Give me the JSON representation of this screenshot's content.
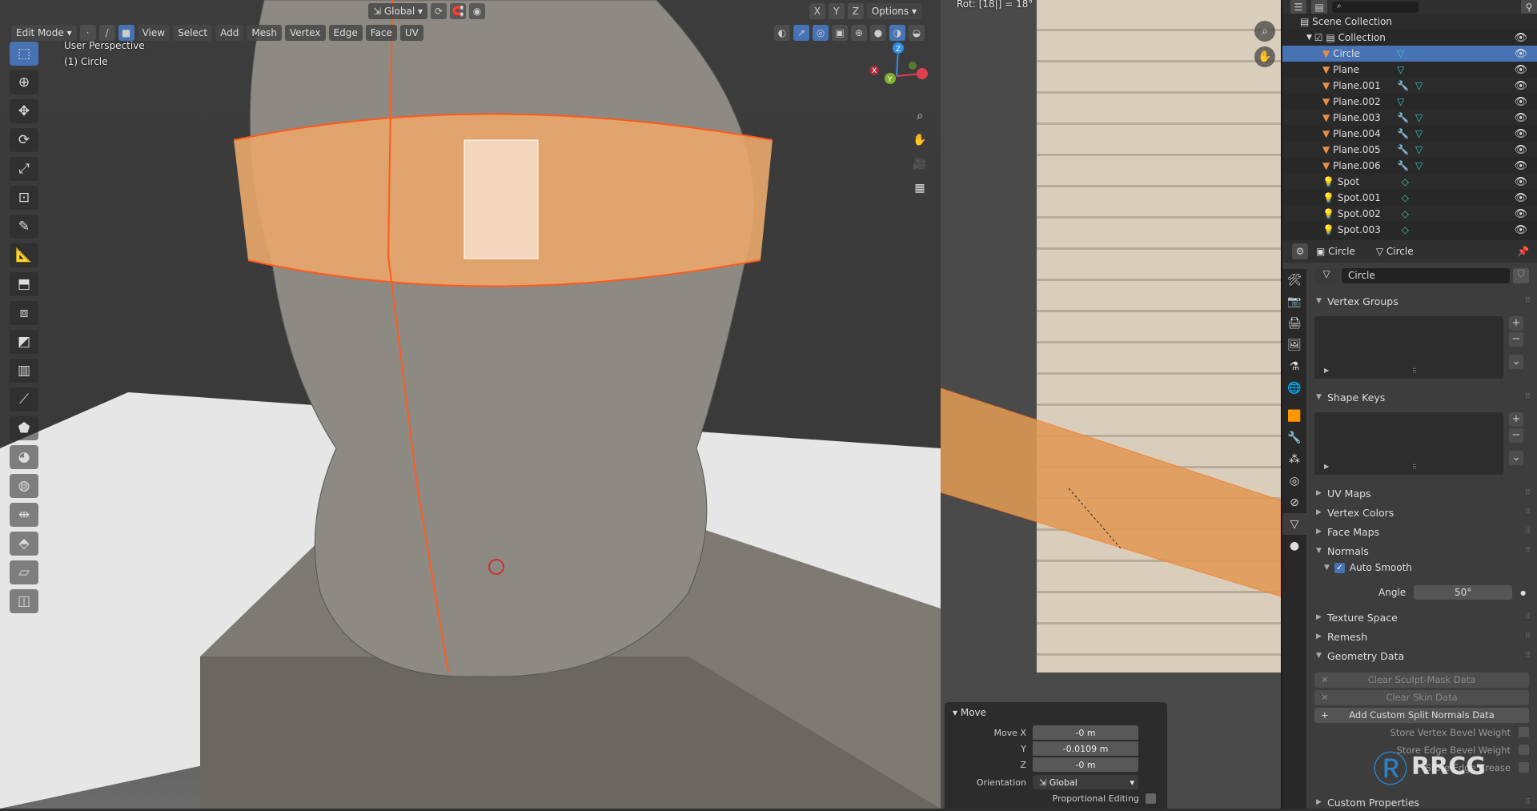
{
  "topbar": {
    "orientation": "Global",
    "axes": [
      "X",
      "Y",
      "Z"
    ],
    "options": "Options"
  },
  "viewport_header": {
    "mode": "Edit Mode",
    "menus": [
      "View",
      "Select",
      "Add",
      "Mesh",
      "Vertex",
      "Edge",
      "Face",
      "UV"
    ]
  },
  "viewport": {
    "view_name": "User Perspective",
    "object_label": "(1) Circle",
    "gizmo_axes": [
      "Z",
      "Y",
      "X"
    ]
  },
  "tools": [
    "select-box",
    "cursor",
    "move",
    "rotate",
    "scale",
    "transform",
    "annotate",
    "measure",
    "extrude-region",
    "inset-faces",
    "bevel",
    "loop-cut",
    "knife",
    "poly-build",
    "spin",
    "smooth",
    "edge-slide",
    "shrink-fatten",
    "shear",
    "rip-region"
  ],
  "uv_editor": {
    "status": "Rot: [18|] = 18°"
  },
  "move_panel": {
    "title": "Move",
    "move_x_label": "Move X",
    "move_x": "-0 m",
    "y_label": "Y",
    "move_y": "-0.0109 m",
    "z_label": "Z",
    "move_z": "-0 m",
    "orientation_label": "Orientation",
    "orientation": "Global",
    "proportional_label": "Proportional Editing"
  },
  "outliner": {
    "scene": "Scene Collection",
    "collection": "Collection",
    "items": [
      {
        "name": "Circle",
        "type": "mesh",
        "modifier": false,
        "selected": true
      },
      {
        "name": "Plane",
        "type": "mesh",
        "modifier": false
      },
      {
        "name": "Plane.001",
        "type": "mesh",
        "modifier": true
      },
      {
        "name": "Plane.002",
        "type": "mesh",
        "modifier": false
      },
      {
        "name": "Plane.003",
        "type": "mesh",
        "modifier": true
      },
      {
        "name": "Plane.004",
        "type": "mesh",
        "modifier": true
      },
      {
        "name": "Plane.005",
        "type": "mesh",
        "modifier": true
      },
      {
        "name": "Plane.006",
        "type": "mesh",
        "modifier": true
      },
      {
        "name": "Spot",
        "type": "light"
      },
      {
        "name": "Spot.001",
        "type": "light"
      },
      {
        "name": "Spot.002",
        "type": "light"
      },
      {
        "name": "Spot.003",
        "type": "light"
      }
    ]
  },
  "properties": {
    "object": "Circle",
    "data": "Circle",
    "mesh_name": "Circle",
    "sections": {
      "vertex_groups": "Vertex Groups",
      "shape_keys": "Shape Keys",
      "uv_maps": "UV Maps",
      "vertex_colors": "Vertex Colors",
      "face_maps": "Face Maps",
      "normals": "Normals",
      "texture_space": "Texture Space",
      "remesh": "Remesh",
      "geometry_data": "Geometry Data",
      "custom_properties": "Custom Properties"
    },
    "auto_smooth_label": "Auto Smooth",
    "auto_smooth": true,
    "angle_label": "Angle",
    "angle": "50°",
    "clear_sculpt": "Clear Sculpt-Mask Data",
    "clear_skin": "Clear Skin Data",
    "add_split_normals": "Add Custom Split Normals Data",
    "store_vertex_bevel": "Store Vertex Bevel Weight",
    "store_edge_bevel": "Store Edge Bevel Weight",
    "store_edge_crease": "Store Edge Crease"
  },
  "colors": {
    "accent": "#4772b3",
    "selection": "#f0a060",
    "edge": "#ff5a1e"
  }
}
